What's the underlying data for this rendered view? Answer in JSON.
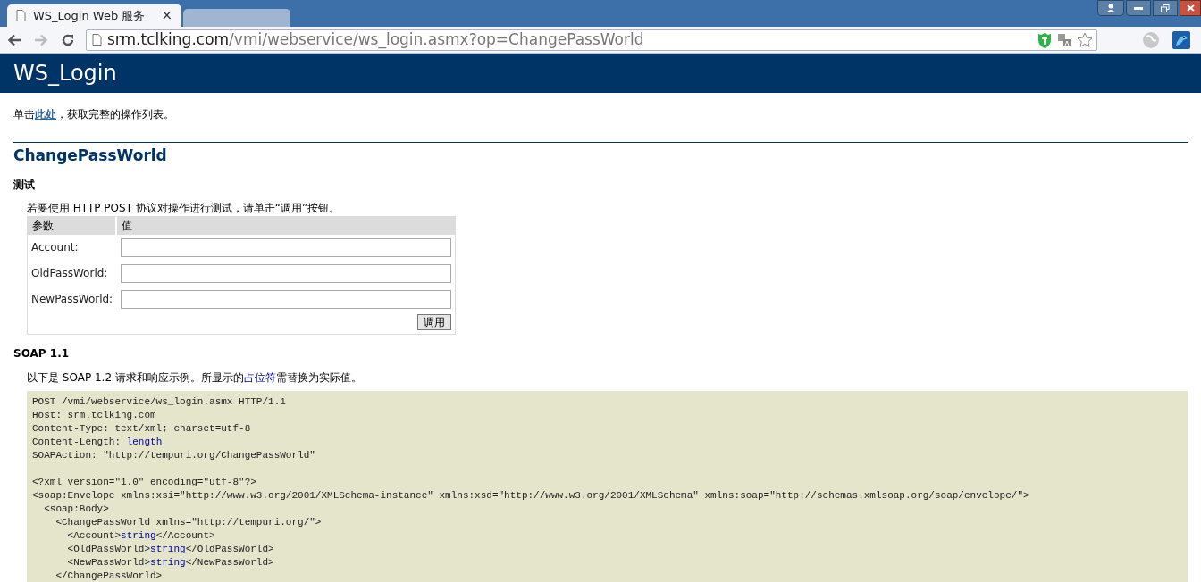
{
  "browser": {
    "tabs": [
      {
        "title": "WS_Login Web 服务",
        "close": "×",
        "selected": true
      },
      {
        "selected": false
      }
    ],
    "nav": {
      "back_disabled": false,
      "forward_disabled": true
    },
    "address": {
      "host": "srm.tclking.com",
      "path": "/vmi/webservice/ws_login.asmx?op=ChangePassWorld"
    }
  },
  "page": {
    "heading": "WS_Login",
    "intro": {
      "before": "单击",
      "link": "此处",
      "after": "，获取完整的操作列表。"
    },
    "operation": "ChangePassWorld",
    "test": {
      "heading": "测试",
      "note": "若要使用 HTTP POST 协议对操作进行测试，请单击“调用”按钮。",
      "columns": [
        "参数",
        "值"
      ],
      "params": [
        {
          "label": "Account:"
        },
        {
          "label": "OldPassWorld:"
        },
        {
          "label": "NewPassWorld:"
        }
      ],
      "invoke": "调用"
    },
    "soap": {
      "heading": "SOAP 1.1",
      "note": {
        "before": "以下是 SOAP 1.2 请求和响应示例。所显示的",
        "link": "占位符",
        "after": "需替换为实际值。"
      },
      "code": [
        [
          [
            {
              "text": "POST /vmi/webservice/ws_login.asmx HTTP/1.1",
              "placeholder": false
            }
          ],
          [
            {
              "text": "Host: srm.tclking.com",
              "placeholder": false
            }
          ],
          [
            {
              "text": "Content-Type: text/xml; charset=utf-8",
              "placeholder": false
            }
          ],
          [
            {
              "text": "Content-Length: ",
              "placeholder": false
            },
            {
              "text": "length",
              "placeholder": true
            }
          ],
          [
            {
              "text": "SOAPAction: \"http://tempuri.org/ChangePassWorld\"",
              "placeholder": false
            }
          ]
        ],
        [
          [
            {
              "text": "<?xml version=\"1.0\" encoding=\"utf-8\"?>",
              "placeholder": false
            }
          ],
          [
            {
              "text": "<soap:Envelope xmlns:xsi=\"http://www.w3.org/2001/XMLSchema-instance\" xmlns:xsd=\"http://www.w3.org/2001/XMLSchema\" xmlns:soap=\"http://schemas.xmlsoap.org/soap/envelope/\">",
              "placeholder": false
            }
          ],
          [
            {
              "text": "  <soap:Body>",
              "placeholder": false
            }
          ],
          [
            {
              "text": "    <ChangePassWorld xmlns=\"http://tempuri.org/\">",
              "placeholder": false
            }
          ],
          [
            {
              "text": "      <Account>",
              "placeholder": false
            },
            {
              "text": "string",
              "placeholder": true
            },
            {
              "text": "</Account>",
              "placeholder": false
            }
          ],
          [
            {
              "text": "      <OldPassWorld>",
              "placeholder": false
            },
            {
              "text": "string",
              "placeholder": true
            },
            {
              "text": "</OldPassWorld>",
              "placeholder": false
            }
          ],
          [
            {
              "text": "      <NewPassWorld>",
              "placeholder": false
            },
            {
              "text": "string",
              "placeholder": true
            },
            {
              "text": "</NewPassWorld>",
              "placeholder": false
            }
          ],
          [
            {
              "text": "    </ChangePassWorld>",
              "placeholder": false
            }
          ]
        ]
      ]
    }
  }
}
